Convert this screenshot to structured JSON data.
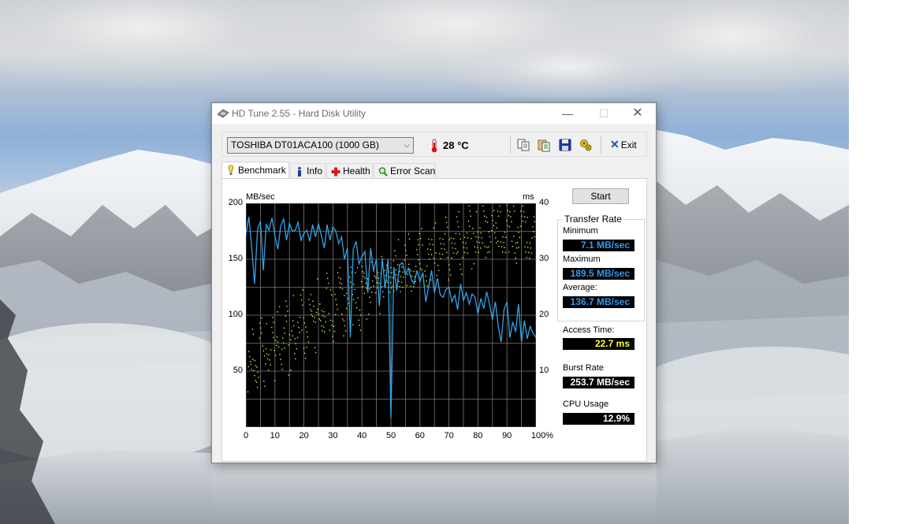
{
  "window": {
    "title": "HD Tune 2.55 - Hard Disk Utility",
    "minimize_glyph": "—",
    "maximize_glyph": "☐",
    "close_glyph": "✕"
  },
  "toolbar": {
    "drive": "TOSHIBA DT01ACA100 (1000 GB)",
    "temperature": "28 °C",
    "exit_label": "Exit",
    "icons": [
      "copy-icon",
      "copy-text-icon",
      "save-icon",
      "options-icon",
      "exit-icon"
    ]
  },
  "tabs": [
    {
      "label": "Benchmark",
      "icon": "benchmark-icon",
      "active": true
    },
    {
      "label": "Info",
      "icon": "info-icon",
      "active": false
    },
    {
      "label": "Health",
      "icon": "health-icon",
      "active": false
    },
    {
      "label": "Error Scan",
      "icon": "error-scan-icon",
      "active": false
    }
  ],
  "benchmark": {
    "start_label": "Start",
    "transfer_rate_title": "Transfer Rate",
    "minimum_label": "Minimum",
    "minimum_value": "7.1 MB/sec",
    "maximum_label": "Maximum",
    "maximum_value": "189.5 MB/sec",
    "average_label": "Average:",
    "average_value": "136.7 MB/sec",
    "access_time_label": "Access Time:",
    "access_time_value": "22.7 ms",
    "burst_rate_label": "Burst Rate",
    "burst_rate_value": "253.7 MB/sec",
    "cpu_usage_label": "CPU Usage",
    "cpu_usage_value": "12.9%"
  },
  "chart_data": {
    "type": "line",
    "title": "",
    "xlabel": "",
    "ylabel": "MB/sec",
    "y2label": "ms",
    "xlim": [
      0,
      100
    ],
    "ylim": [
      0,
      200
    ],
    "y2lim": [
      0,
      40
    ],
    "x_ticks": [
      "0",
      "10",
      "20",
      "30",
      "40",
      "50",
      "60",
      "70",
      "80",
      "90",
      "100%"
    ],
    "y_ticks": [
      "50",
      "100",
      "150",
      "200"
    ],
    "y2_ticks": [
      "10",
      "20",
      "30",
      "40"
    ],
    "grid": true,
    "colors": {
      "transfer": "#2fa4e7",
      "access": "#e6e64a",
      "grid": "#7a7a7a",
      "background": "#000000"
    },
    "series": [
      {
        "axis": "left",
        "x": [
          0,
          1,
          2,
          3,
          4,
          5,
          6,
          7,
          8,
          9,
          10,
          11,
          12,
          13,
          14,
          15,
          16,
          17,
          18,
          19,
          20,
          21,
          22,
          23,
          24,
          25,
          26,
          27,
          28,
          29,
          30,
          31,
          32,
          33,
          34,
          35,
          36,
          37,
          38,
          39,
          40,
          41,
          42,
          43,
          44,
          45,
          46,
          47,
          48,
          49,
          50,
          51,
          52,
          53,
          54,
          55,
          56,
          57,
          58,
          59,
          60,
          61,
          62,
          63,
          64,
          65,
          66,
          67,
          68,
          69,
          70,
          71,
          72,
          73,
          74,
          75,
          76,
          77,
          78,
          79,
          80,
          81,
          82,
          83,
          84,
          85,
          86,
          87,
          88,
          89,
          90,
          91,
          92,
          93,
          94,
          95,
          96,
          97,
          98,
          99,
          100
        ],
        "values": [
          172,
          188,
          160,
          128,
          176,
          184,
          140,
          181,
          176,
          187,
          171,
          159,
          180,
          186,
          167,
          182,
          175,
          176,
          183,
          167,
          173,
          176,
          166,
          181,
          170,
          182,
          171,
          160,
          181,
          167,
          179,
          175,
          164,
          170,
          150,
          160,
          80,
          159,
          166,
          146,
          152,
          157,
          120,
          160,
          140,
          150,
          108,
          151,
          124,
          150,
          8,
          143,
          122,
          145,
          147,
          136,
          142,
          132,
          128,
          140,
          130,
          138,
          112,
          125,
          140,
          120,
          133,
          118,
          116,
          123,
          125,
          112,
          118,
          105,
          128,
          113,
          120,
          110,
          119,
          116,
          101,
          115,
          106,
          121,
          110,
          96,
          112,
          90,
          76,
          105,
          112,
          80,
          94,
          85,
          110,
          76,
          95,
          79,
          90,
          84,
          80
        ]
      },
      {
        "axis": "right",
        "x": [
          1,
          2,
          3,
          4,
          5,
          6,
          7,
          8,
          9,
          10,
          11,
          12,
          13,
          14,
          15,
          16,
          17,
          18,
          19,
          20,
          21,
          22,
          23,
          24,
          25,
          26,
          27,
          28,
          29,
          30,
          31,
          32,
          33,
          34,
          35,
          36,
          37,
          38,
          39,
          40,
          41,
          42,
          43,
          44,
          45,
          46,
          47,
          48,
          49,
          50,
          51,
          52,
          53,
          54,
          55,
          56,
          57,
          58,
          59,
          60,
          61,
          62,
          63,
          64,
          65,
          66,
          67,
          68,
          69,
          70,
          71,
          72,
          73,
          74,
          75,
          76,
          77,
          78,
          79,
          80,
          81,
          82,
          83,
          84,
          85,
          86,
          87,
          88,
          89,
          90,
          91,
          92,
          93,
          94,
          95,
          96,
          97,
          98,
          99
        ],
        "values": [
          10,
          14,
          12,
          9,
          16,
          11,
          15,
          13,
          17,
          12,
          18,
          14,
          16,
          19,
          13,
          20,
          15,
          17,
          21,
          16,
          18,
          22,
          19,
          17,
          23,
          20,
          18,
          24,
          21,
          19,
          22,
          25,
          23,
          20,
          24,
          26,
          22,
          25,
          21,
          27,
          24,
          23,
          26,
          28,
          25,
          24,
          27,
          29,
          26,
          25,
          28,
          30,
          27,
          26,
          29,
          31,
          28,
          27,
          30,
          32,
          29,
          28,
          31,
          30,
          33,
          29,
          32,
          31,
          34,
          30,
          33,
          32,
          35,
          31,
          34,
          33,
          36,
          32,
          35,
          34,
          33,
          36,
          34,
          35,
          37,
          33,
          36,
          35,
          34,
          37,
          35,
          36,
          33,
          34,
          36,
          35,
          34,
          33,
          35
        ]
      }
    ]
  }
}
